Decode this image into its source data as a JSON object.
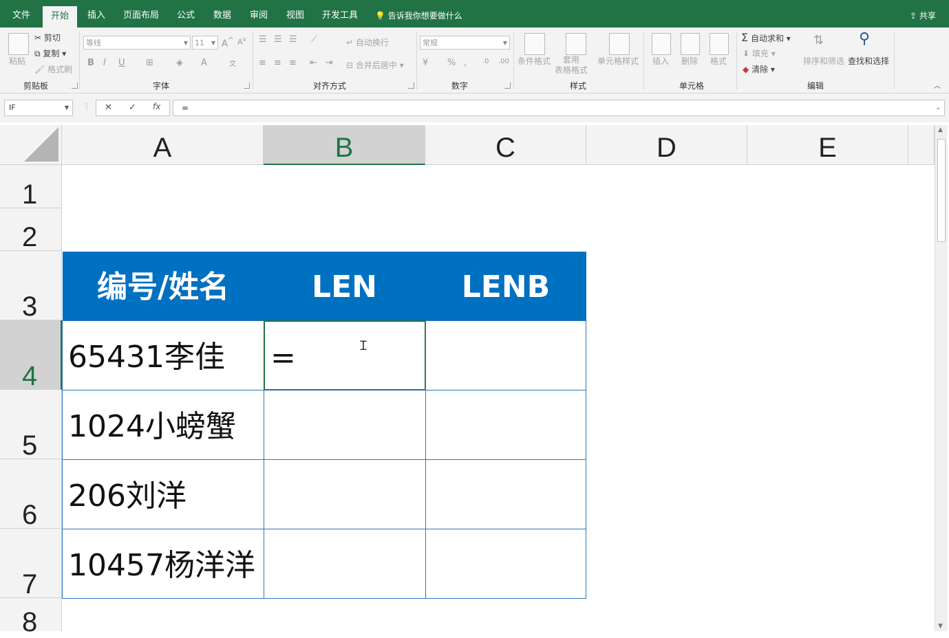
{
  "tabs": [
    "文件",
    "开始",
    "插入",
    "页面布局",
    "公式",
    "数据",
    "审阅",
    "视图",
    "开发工具"
  ],
  "tell_me": "告诉我你想要做什么",
  "share": "共享",
  "ribbon": {
    "clipboard": {
      "paste": "粘贴",
      "cut": "剪切",
      "copy": "复制",
      "format_painter": "格式刷",
      "label": "剪贴板"
    },
    "font": {
      "name": "等线",
      "size": "11",
      "bold": "B",
      "italic": "I",
      "underline": "U",
      "label": "字体"
    },
    "alignment": {
      "wrap": "自动换行",
      "merge": "合并后居中",
      "label": "对齐方式"
    },
    "number": {
      "format": "常规",
      "percent": "%",
      "label": "数字"
    },
    "styles": {
      "conditional": "条件格式",
      "table": "套用\n表格格式",
      "cell_styles": "单元格样式",
      "label": "样式"
    },
    "cells": {
      "insert": "插入",
      "delete": "删除",
      "format": "格式",
      "label": "单元格"
    },
    "editing": {
      "autosum": "自动求和",
      "fill": "填充",
      "clear": "清除",
      "sort": "排序和筛选",
      "find": "查找和选择",
      "label": "编辑"
    }
  },
  "formula_bar": {
    "name_box": "IF",
    "formula": "="
  },
  "columns": [
    "A",
    "B",
    "C",
    "D",
    "E"
  ],
  "rows": [
    "1",
    "2",
    "3",
    "4",
    "5",
    "6",
    "7",
    "8"
  ],
  "table": {
    "headers": [
      "编号/姓名",
      "LEN",
      "LENB"
    ],
    "rows": [
      [
        "65431李佳",
        "=",
        ""
      ],
      [
        "1024小螃蟹",
        "",
        ""
      ],
      [
        "206刘洋",
        "",
        ""
      ],
      [
        "10457杨洋洋",
        "",
        ""
      ]
    ]
  }
}
